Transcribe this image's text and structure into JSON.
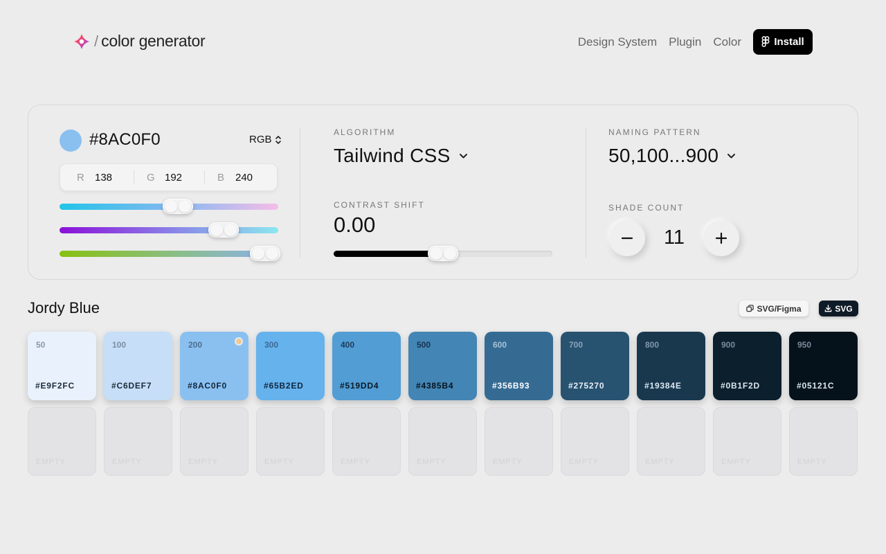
{
  "header": {
    "brand_slash": "/",
    "brand_name": "color generator",
    "nav": [
      "Design System",
      "Plugin",
      "Color"
    ],
    "install_label": "Install"
  },
  "color_input": {
    "hex": "#8AC0F0",
    "swatch_color": "#8AC0F0",
    "mode": "RGB",
    "r_label": "R",
    "r": "138",
    "g_label": "G",
    "g": "192",
    "b_label": "B",
    "b": "240",
    "slider_fractions": {
      "r": 0.54,
      "g": 0.75,
      "b": 0.94
    }
  },
  "algorithm": {
    "label": "ALGORITHM",
    "value": "Tailwind CSS"
  },
  "contrast": {
    "label": "CONTRAST SHIFT",
    "value": "0.00",
    "fraction": 0.5
  },
  "naming": {
    "label": "NAMING PATTERN",
    "value": "50,100...900"
  },
  "shade_count": {
    "label": "SHADE COUNT",
    "value": "11",
    "minus_icon": "minus-icon",
    "plus_icon": "plus-icon"
  },
  "palette": {
    "name": "Jordy Blue",
    "figma_button": "SVG/Figma",
    "svg_button": "SVG",
    "shades": [
      {
        "step": "50",
        "hex": "#E9F2FC",
        "color": "#E9F2FC",
        "text_color": "#1a2a3a",
        "step_color": "#8a98a8"
      },
      {
        "step": "100",
        "hex": "#C6DEF7",
        "color": "#C6DEF7",
        "text_color": "#1a2a3a",
        "step_color": "#7a8ea4"
      },
      {
        "step": "200",
        "hex": "#8AC0F0",
        "color": "#8AC0F0",
        "text_color": "#10263c",
        "step_color": "#4a6e90"
      },
      {
        "step": "300",
        "hex": "#65B2ED",
        "color": "#65B2ED",
        "text_color": "#10263c",
        "step_color": "#3d6a94"
      },
      {
        "step": "400",
        "hex": "#519DD4",
        "color": "#519DD4",
        "text_color": "#0a1826",
        "step_color": "#1d3c5a"
      },
      {
        "step": "500",
        "hex": "#4385B4",
        "color": "#4385B4",
        "text_color": "#06121e",
        "step_color": "#173450"
      },
      {
        "step": "600",
        "hex": "#356B93",
        "color": "#356B93",
        "text_color": "#ffffff",
        "step_color": "#a8c2d8"
      },
      {
        "step": "700",
        "hex": "#275270",
        "color": "#275270",
        "text_color": "#e8f0f8",
        "step_color": "#8aa4bc"
      },
      {
        "step": "800",
        "hex": "#19384E",
        "color": "#19384E",
        "text_color": "#dde8f2",
        "step_color": "#8198ac"
      },
      {
        "step": "900",
        "hex": "#0B1F2D",
        "color": "#0B1F2D",
        "text_color": "#dde6ee",
        "step_color": "#7a8c9c"
      },
      {
        "step": "950",
        "hex": "#05121C",
        "color": "#05121C",
        "text_color": "#dde6ee",
        "step_color": "#7a8a98"
      }
    ],
    "empty_label": "EMPTY"
  }
}
